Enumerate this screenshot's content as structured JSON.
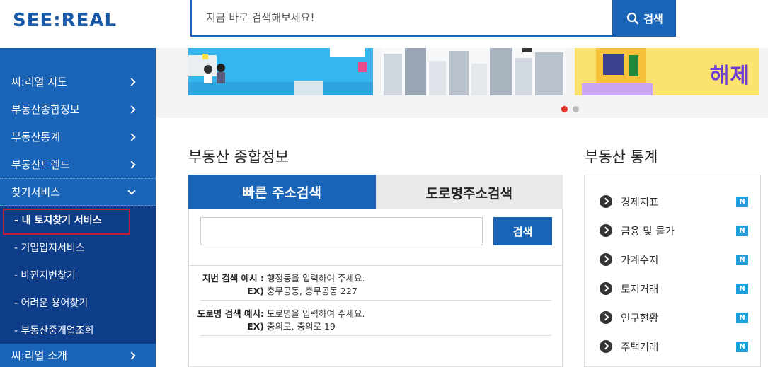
{
  "brand": {
    "logo": "SEE:REAL"
  },
  "search": {
    "placeholder": "지금 바로 검색해보세요!",
    "button_label": "검색"
  },
  "sidebar": {
    "items": [
      {
        "label": "씨:리얼 지도"
      },
      {
        "label": "부동산종합정보"
      },
      {
        "label": "부동산통계"
      },
      {
        "label": "부동산트렌드"
      },
      {
        "label": "찾기서비스"
      }
    ],
    "submenu": [
      {
        "label": "- 내 토지찾기 서비스"
      },
      {
        "label": "- 기업입지서비스"
      },
      {
        "label": "- 바뀐지번찾기"
      },
      {
        "label": "- 어려운 용어찾기"
      },
      {
        "label": "- 부동산중개업조회"
      }
    ],
    "last_item": {
      "label": "씨:리얼 소개"
    }
  },
  "banner": {
    "overlay_text": "해제"
  },
  "info": {
    "title": "부동산 종합정보",
    "tabs": [
      {
        "label": "빠른 주소검색"
      },
      {
        "label": "도로명주소검색"
      }
    ],
    "search_button": "검색",
    "examples": [
      {
        "label": "지번 검색 예시 :",
        "text": "행정동을 입력하여 주세요.",
        "ex_label": "EX)",
        "ex_text": "충무공동, 충무공동 227"
      },
      {
        "label": "도로명 검색 예시:",
        "text": "도로명을 입력하여 주세요.",
        "ex_label": "EX)",
        "ex_text": "충의로, 충의로 19"
      }
    ]
  },
  "stats": {
    "title": "부동산 통계",
    "badge": "N",
    "items": [
      {
        "label": "경제지표"
      },
      {
        "label": "금융 및 물가"
      },
      {
        "label": "가계수지"
      },
      {
        "label": "토지거래"
      },
      {
        "label": "인구현황"
      },
      {
        "label": "주택거래"
      }
    ]
  },
  "colors": {
    "primary": "#1a64b8",
    "sidebar_sub": "#0e3e8a",
    "badge": "#1ea0dc",
    "highlight": "#c02030"
  }
}
